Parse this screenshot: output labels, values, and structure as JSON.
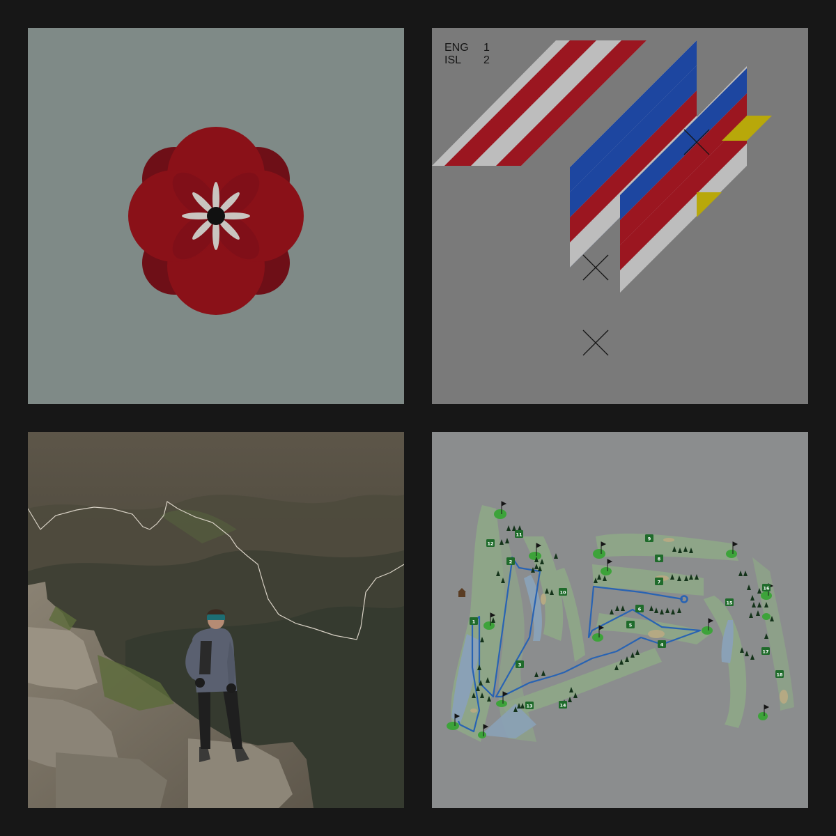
{
  "tiles": {
    "poppy": {
      "colors": {
        "background": "#7f8a87",
        "petal": "#8a1118",
        "petal_dark": "#6e0f17",
        "center": "#111111",
        "stamen": "#c9c5c0"
      }
    },
    "flags": {
      "score": [
        {
          "team": "ENG",
          "goals": "1"
        },
        {
          "team": "ISL",
          "goals": "2"
        }
      ],
      "colors": {
        "background": "#7a7a7a",
        "red": "#9b1620",
        "white": "#bdbdbd",
        "blue": "#1d46a0",
        "yellow": "#b8a80a"
      },
      "icons": [
        "cross-mark-icon"
      ]
    },
    "hiker": {
      "colors": {
        "sky": "#5a5246",
        "trail_line": "#d9d2c6"
      }
    },
    "golf": {
      "holes": [
        "1",
        "2",
        "3",
        "4",
        "5",
        "6",
        "7",
        "8",
        "9",
        "10",
        "11",
        "12",
        "13",
        "14",
        "15",
        "16",
        "17",
        "18"
      ],
      "colors": {
        "background": "#8b8d8e",
        "fairway": "#8fae86",
        "green": "#3da33a",
        "water": "#8aa1b6",
        "route": "#2863b3",
        "tree": "#14331a",
        "label_bg": "#1f6b2b"
      },
      "icons": [
        "flag-icon",
        "tree-icon",
        "clubhouse-icon"
      ]
    }
  }
}
